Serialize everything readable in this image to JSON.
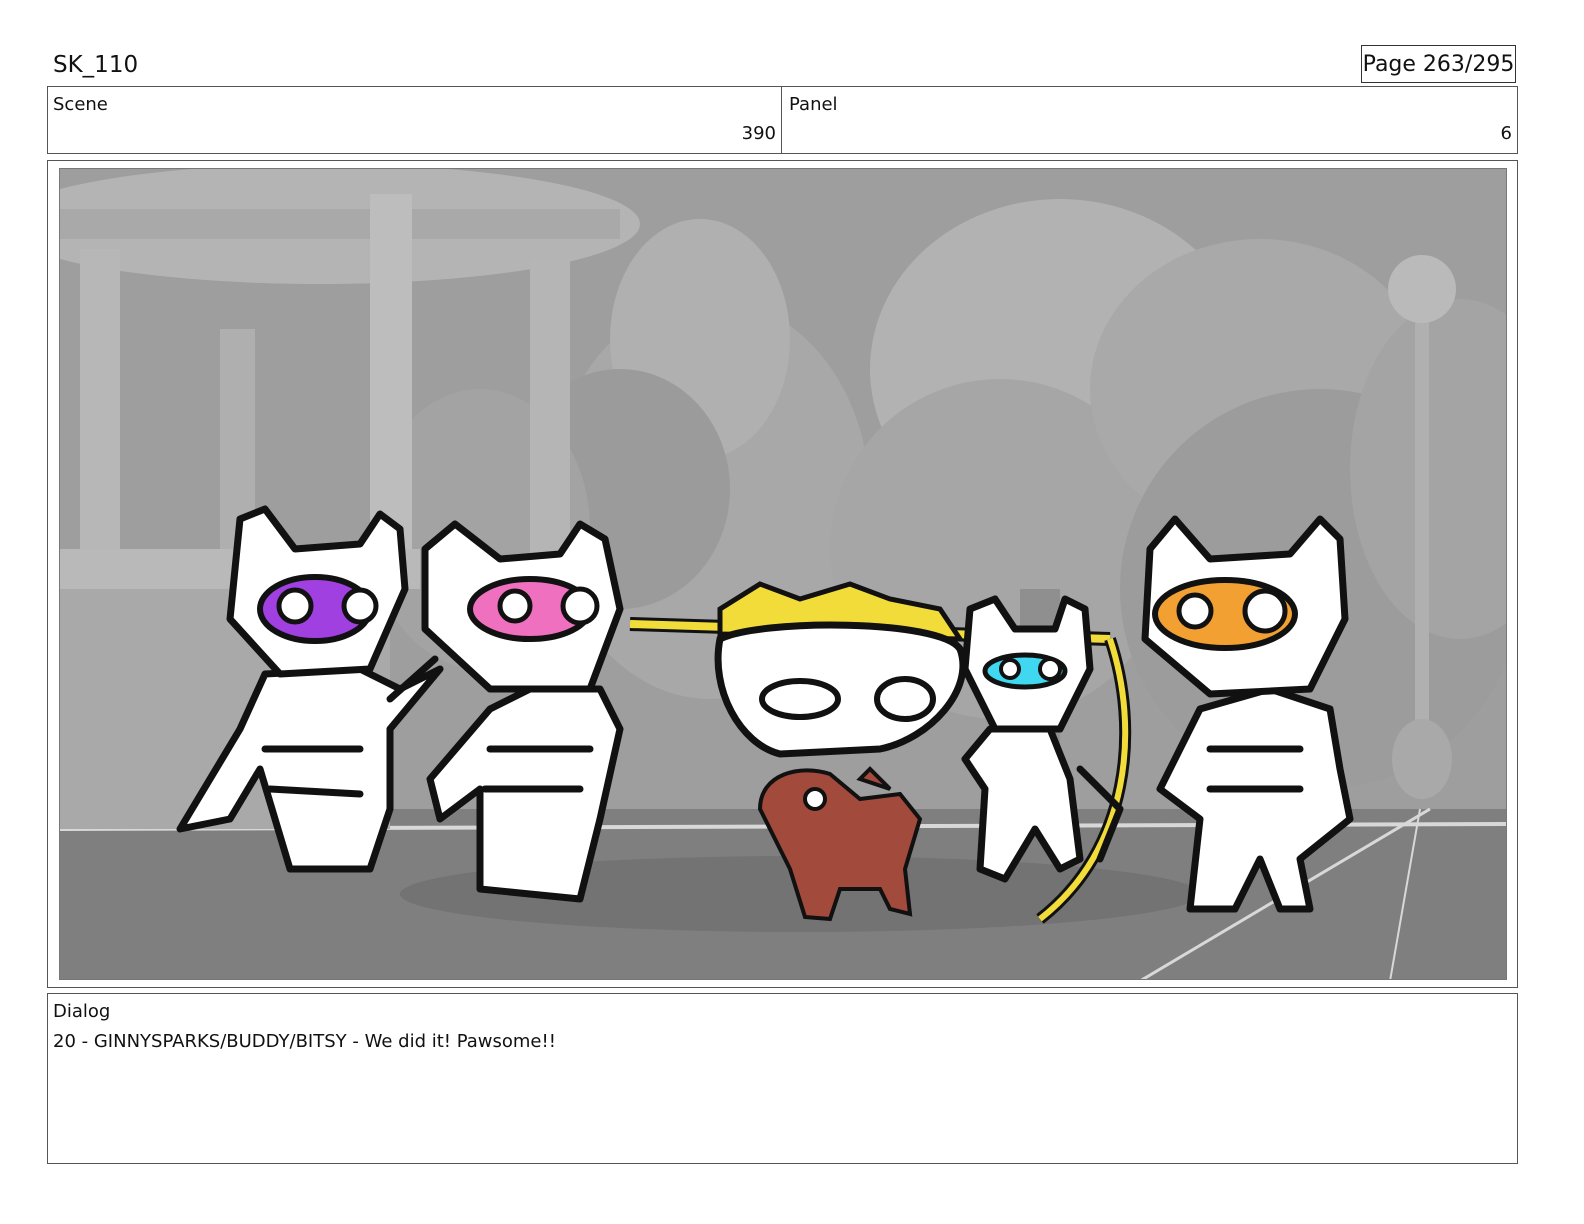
{
  "header": {
    "title": "SK_110",
    "page": "Page 263/295"
  },
  "info": {
    "scene_label": "Scene",
    "scene_value": "390",
    "panel_label": "Panel",
    "panel_value": "6"
  },
  "dialog": {
    "label": "Dialog",
    "text": "20 - GINNYSPARKS/BUDDY/BITSY - We did it! Pawsome!!"
  },
  "colors": {
    "mask_purple": "#a040e0",
    "mask_pink": "#f070c0",
    "mask_cyan": "#40d8f0",
    "mask_orange": "#f2a032",
    "ribbon_yellow": "#f2dc3a",
    "dog_brown": "#a24a3c",
    "background_gray": "#9a9a9a"
  }
}
